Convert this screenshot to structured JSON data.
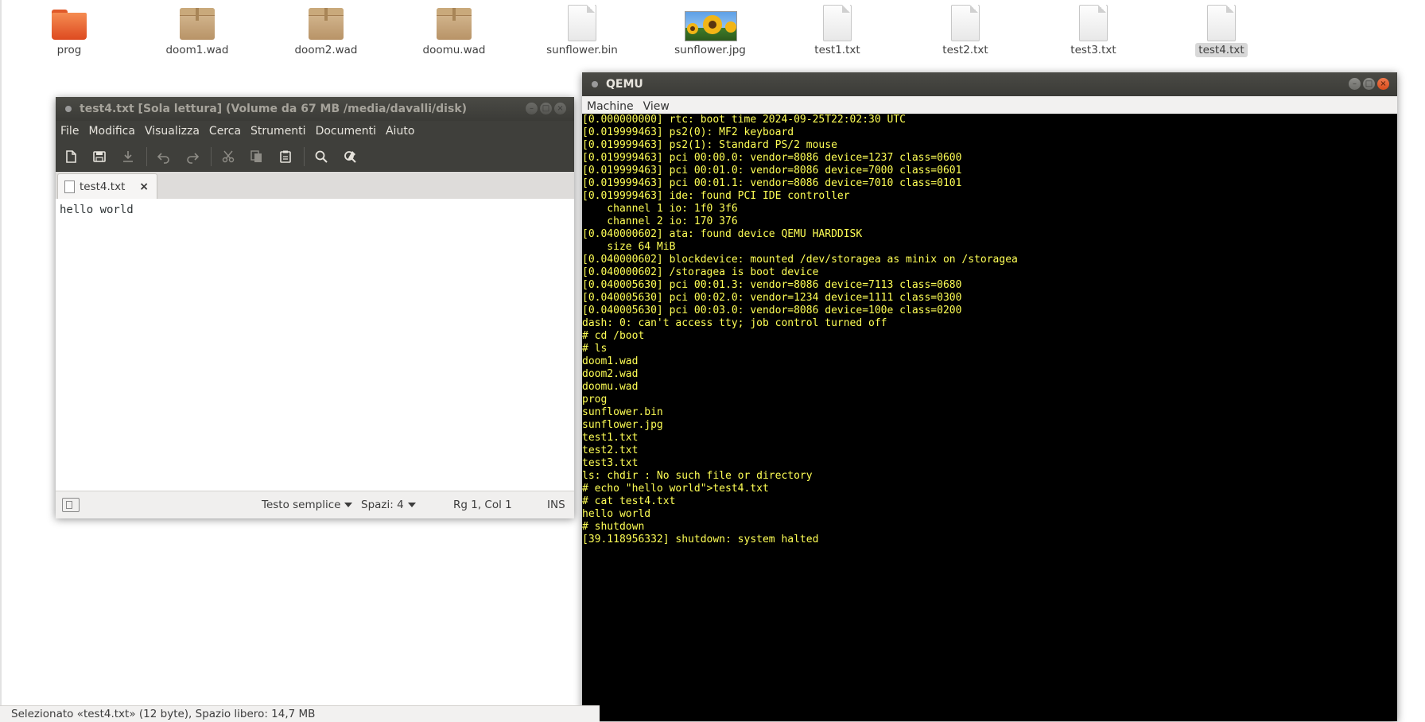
{
  "desktop": {
    "files": [
      {
        "name": "prog",
        "type": "folder",
        "selected": false
      },
      {
        "name": "doom1.wad",
        "type": "archive",
        "selected": false
      },
      {
        "name": "doom2.wad",
        "type": "archive",
        "selected": false
      },
      {
        "name": "doomu.wad",
        "type": "archive",
        "selected": false
      },
      {
        "name": "sunflower.bin",
        "type": "document",
        "selected": false
      },
      {
        "name": "sunflower.jpg",
        "type": "image",
        "selected": false
      },
      {
        "name": "test1.txt",
        "type": "document",
        "selected": false
      },
      {
        "name": "test2.txt",
        "type": "document",
        "selected": false
      },
      {
        "name": "test3.txt",
        "type": "document",
        "selected": false
      },
      {
        "name": "test4.txt",
        "type": "document",
        "selected": true
      }
    ],
    "status": "Selezionato «test4.txt» (12 byte), Spazio libero: 14,7 MB"
  },
  "gedit": {
    "title": "test4.txt [Sola lettura] (Volume da 67 MB /media/davalli/disk)",
    "menu": [
      "File",
      "Modifica",
      "Visualizza",
      "Cerca",
      "Strumenti",
      "Documenti",
      "Aiuto"
    ],
    "toolbar_icons": [
      "new-document-icon",
      "save-icon",
      "download-icon",
      "undo-icon",
      "redo-icon",
      "cut-icon",
      "copy-icon",
      "paste-icon",
      "search-icon",
      "find-replace-icon"
    ],
    "tab": {
      "label": "test4.txt",
      "close": "×"
    },
    "content": "hello world",
    "status": {
      "language": "Testo semplice",
      "spaces": "Spazi: 4",
      "position": "Rg 1, Col 1",
      "mode": "INS"
    }
  },
  "qemu": {
    "title": "QEMU",
    "menu": [
      "Machine",
      "View"
    ],
    "console": [
      "[0.000000000] rtc: boot time 2024-09-25T22:02:30 UTC",
      "[0.019999463] ps2(0): MF2 keyboard",
      "[0.019999463] ps2(1): Standard PS/2 mouse",
      "[0.019999463] pci 00:00.0: vendor=8086 device=1237 class=0600",
      "[0.019999463] pci 00:01.0: vendor=8086 device=7000 class=0601",
      "[0.019999463] pci 00:01.1: vendor=8086 device=7010 class=0101",
      "[0.019999463] ide: found PCI IDE controller",
      "    channel 1 io: 1f0 3f6",
      "    channel 2 io: 170 376",
      "[0.040000602] ata: found device QEMU HARDDISK",
      "    size 64 MiB",
      "[0.040000602] blockdevice: mounted /dev/storagea as minix on /storagea",
      "[0.040000602] /storagea is boot device",
      "[0.040005630] pci 00:01.3: vendor=8086 device=7113 class=0680",
      "[0.040005630] pci 00:02.0: vendor=1234 device=1111 class=0300",
      "[0.040005630] pci 00:03.0: vendor=8086 device=100e class=0200",
      "dash: 0: can't access tty; job control turned off",
      "# cd /boot",
      "# ls",
      "doom1.wad",
      "doom2.wad",
      "doomu.wad",
      "prog",
      "sunflower.bin",
      "sunflower.jpg",
      "test1.txt",
      "test2.txt",
      "test3.txt",
      "ls: chdir : No such file or directory",
      "# echo \"hello world\">test4.txt",
      "# cat test4.txt",
      "hello world",
      "# shutdown",
      "[39.118956332] shutdown: system halted"
    ]
  },
  "colors": {
    "console_text": "#ffff55",
    "console_bg": "#000000",
    "titlebar": "#3f3f3b",
    "close_button": "#e2572a"
  }
}
